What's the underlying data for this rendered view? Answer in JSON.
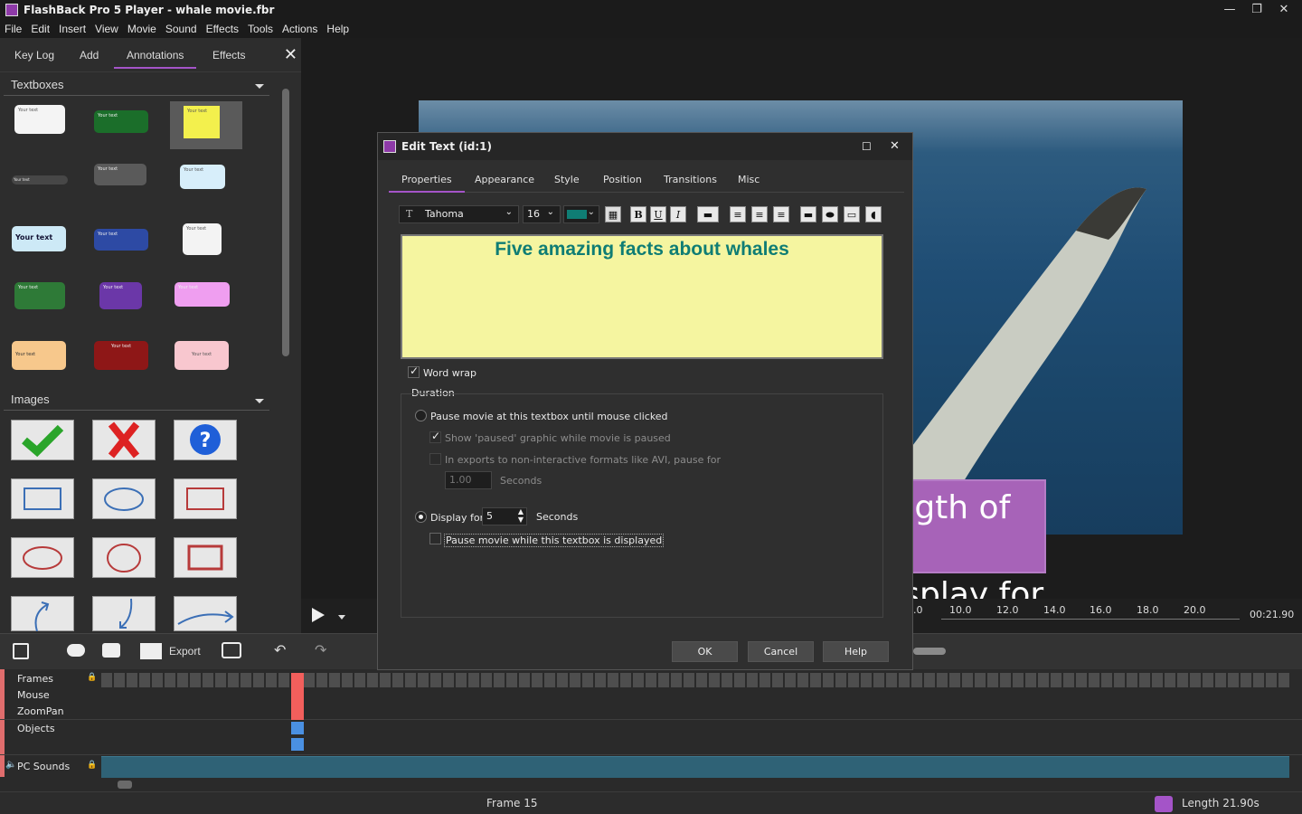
{
  "window": {
    "title": "FlashBack Pro 5 Player - whale movie.fbr"
  },
  "menu": [
    "File",
    "Edit",
    "Insert",
    "View",
    "Movie",
    "Sound",
    "Effects",
    "Tools",
    "Actions",
    "Help"
  ],
  "left_tabs": {
    "keylog": "Key Log",
    "add": "Add",
    "annotations": "Annotations",
    "effects": "Effects"
  },
  "sections": {
    "textboxes": "Textboxes",
    "images": "Images"
  },
  "textbox_sample": "Your text",
  "timeline": {
    "ticks": [
      "10.0",
      "12.0",
      "14.0",
      "16.0",
      "18.0",
      "20.0"
    ],
    "first_tick_fragment": ".0",
    "time": "00:21.90"
  },
  "toolbar": {
    "export": "Export"
  },
  "tracks": {
    "frames": "Frames",
    "mouse": "Mouse",
    "zoompan": "ZoomPan",
    "objects": "Objects",
    "sounds": "PC Sounds"
  },
  "status": {
    "frame": "Frame 15",
    "length": "Length 21.90s"
  },
  "dialog": {
    "title": "Edit Text (id:1)",
    "tabs": [
      "Properties",
      "Appearance",
      "Style",
      "Position",
      "Transitions",
      "Misc"
    ],
    "font": "Tahoma",
    "size": "16",
    "text_color": "#0f7d74",
    "text": "Five amazing facts about whales",
    "word_wrap": "Word wrap",
    "duration": "Duration",
    "pause_until_click": "Pause movie at this textbox until mouse clicked",
    "show_paused": "Show 'paused' graphic while movie is paused",
    "exports_pause": "In exports to non-interactive formats like AVI, pause for",
    "pause_seconds_value": "1.00",
    "seconds": "Seconds",
    "display_for": "Display for",
    "display_value": "5",
    "seconds2": "Seconds",
    "pause_while_displayed": "Pause movie while this textbox is displayed",
    "ok": "OK",
    "cancel": "Cancel",
    "help": "Help"
  },
  "callout": {
    "line1": "Choose length of time",
    "line2": "text will display for"
  }
}
